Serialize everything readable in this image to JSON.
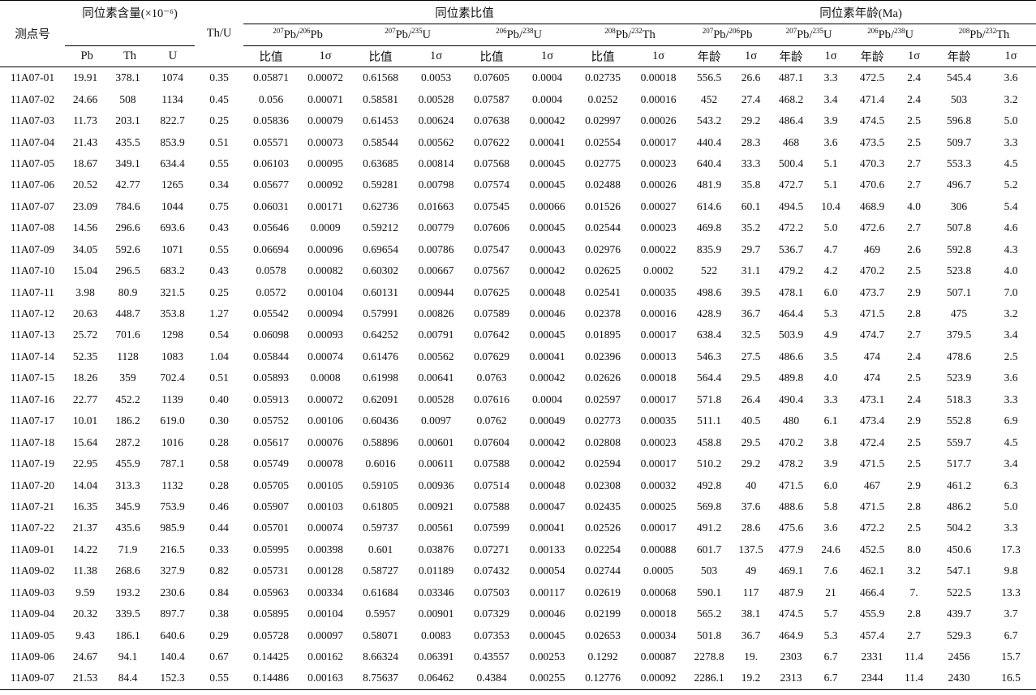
{
  "headers": {
    "point": "测点号",
    "content_group": "同位素含量(×10⁻⁶)",
    "th_u": "Th/U",
    "ratio_group": "同位素比值",
    "age_group": "同位素年龄(Ma)",
    "element_cols": [
      "Pb",
      "Th",
      "U"
    ],
    "pair_labels": [
      {
        "a_mass": "207",
        "a_el": "Pb",
        "b_mass": "206",
        "b_el": "Pb"
      },
      {
        "a_mass": "207",
        "a_el": "Pb",
        "b_mass": "235",
        "b_el": "U"
      },
      {
        "a_mass": "206",
        "a_el": "Pb",
        "b_mass": "238",
        "b_el": "U"
      },
      {
        "a_mass": "208",
        "a_el": "Pb",
        "b_mass": "232",
        "b_el": "Th"
      }
    ],
    "ratio_value": "比值",
    "age_value": "年龄",
    "sigma": "1σ"
  },
  "rows": [
    [
      "11A07-01",
      "19.91",
      "378.1",
      "1074",
      "0.35",
      "0.05871",
      "0.00072",
      "0.61568",
      "0.0053",
      "0.07605",
      "0.0004",
      "0.02735",
      "0.00018",
      "556.5",
      "26.6",
      "487.1",
      "3.3",
      "472.5",
      "2.4",
      "545.4",
      "3.6"
    ],
    [
      "11A07-02",
      "24.66",
      "508",
      "1134",
      "0.45",
      "0.056",
      "0.00071",
      "0.58581",
      "0.00528",
      "0.07587",
      "0.0004",
      "0.0252",
      "0.00016",
      "452",
      "27.4",
      "468.2",
      "3.4",
      "471.4",
      "2.4",
      "503",
      "3.2"
    ],
    [
      "11A07-03",
      "11.73",
      "203.1",
      "822.7",
      "0.25",
      "0.05836",
      "0.00079",
      "0.61453",
      "0.00624",
      "0.07638",
      "0.00042",
      "0.02997",
      "0.00026",
      "543.2",
      "29.2",
      "486.4",
      "3.9",
      "474.5",
      "2.5",
      "596.8",
      "5.0"
    ],
    [
      "11A07-04",
      "21.43",
      "435.5",
      "853.9",
      "0.51",
      "0.05571",
      "0.00073",
      "0.58544",
      "0.00562",
      "0.07622",
      "0.00041",
      "0.02554",
      "0.00017",
      "440.4",
      "28.3",
      "468",
      "3.6",
      "473.5",
      "2.5",
      "509.7",
      "3.3"
    ],
    [
      "11A07-05",
      "18.67",
      "349.1",
      "634.4",
      "0.55",
      "0.06103",
      "0.00095",
      "0.63685",
      "0.00814",
      "0.07568",
      "0.00045",
      "0.02775",
      "0.00023",
      "640.4",
      "33.3",
      "500.4",
      "5.1",
      "470.3",
      "2.7",
      "553.3",
      "4.5"
    ],
    [
      "11A07-06",
      "20.52",
      "42.77",
      "1265",
      "0.34",
      "0.05677",
      "0.00092",
      "0.59281",
      "0.00798",
      "0.07574",
      "0.00045",
      "0.02488",
      "0.00026",
      "481.9",
      "35.8",
      "472.7",
      "5.1",
      "470.6",
      "2.7",
      "496.7",
      "5.2"
    ],
    [
      "11A07-07",
      "23.09",
      "784.6",
      "1044",
      "0.75",
      "0.06031",
      "0.00171",
      "0.62736",
      "0.01663",
      "0.07545",
      "0.00066",
      "0.01526",
      "0.00027",
      "614.6",
      "60.1",
      "494.5",
      "10.4",
      "468.9",
      "4.0",
      "306",
      "5.4"
    ],
    [
      "11A07-08",
      "14.56",
      "296.6",
      "693.6",
      "0.43",
      "0.05646",
      "0.0009",
      "0.59212",
      "0.00779",
      "0.07606",
      "0.00045",
      "0.02544",
      "0.00023",
      "469.8",
      "35.2",
      "472.2",
      "5.0",
      "472.6",
      "2.7",
      "507.8",
      "4.6"
    ],
    [
      "11A07-09",
      "34.05",
      "592.6",
      "1071",
      "0.55",
      "0.06694",
      "0.00096",
      "0.69654",
      "0.00786",
      "0.07547",
      "0.00043",
      "0.02976",
      "0.00022",
      "835.9",
      "29.7",
      "536.7",
      "4.7",
      "469",
      "2.6",
      "592.8",
      "4.3"
    ],
    [
      "11A07-10",
      "15.04",
      "296.5",
      "683.2",
      "0.43",
      "0.0578",
      "0.00082",
      "0.60302",
      "0.00667",
      "0.07567",
      "0.00042",
      "0.02625",
      "0.0002",
      "522",
      "31.1",
      "479.2",
      "4.2",
      "470.2",
      "2.5",
      "523.8",
      "4.0"
    ],
    [
      "11A07-11",
      "3.98",
      "80.9",
      "321.5",
      "0.25",
      "0.0572",
      "0.00104",
      "0.60131",
      "0.00944",
      "0.07625",
      "0.00048",
      "0.02541",
      "0.00035",
      "498.6",
      "39.5",
      "478.1",
      "6.0",
      "473.7",
      "2.9",
      "507.1",
      "7.0"
    ],
    [
      "11A07-12",
      "20.63",
      "448.7",
      "353.8",
      "1.27",
      "0.05542",
      "0.00094",
      "0.57991",
      "0.00826",
      "0.07589",
      "0.00046",
      "0.02378",
      "0.00016",
      "428.9",
      "36.7",
      "464.4",
      "5.3",
      "471.5",
      "2.8",
      "475",
      "3.2"
    ],
    [
      "11A07-13",
      "25.72",
      "701.6",
      "1298",
      "0.54",
      "0.06098",
      "0.00093",
      "0.64252",
      "0.00791",
      "0.07642",
      "0.00045",
      "0.01895",
      "0.00017",
      "638.4",
      "32.5",
      "503.9",
      "4.9",
      "474.7",
      "2.7",
      "379.5",
      "3.4"
    ],
    [
      "11A07-14",
      "52.35",
      "1128",
      "1083",
      "1.04",
      "0.05844",
      "0.00074",
      "0.61476",
      "0.00562",
      "0.07629",
      "0.00041",
      "0.02396",
      "0.00013",
      "546.3",
      "27.5",
      "486.6",
      "3.5",
      "474",
      "2.4",
      "478.6",
      "2.5"
    ],
    [
      "11A07-15",
      "18.26",
      "359",
      "702.4",
      "0.51",
      "0.05893",
      "0.0008",
      "0.61998",
      "0.00641",
      "0.0763",
      "0.00042",
      "0.02626",
      "0.00018",
      "564.4",
      "29.5",
      "489.8",
      "4.0",
      "474",
      "2.5",
      "523.9",
      "3.6"
    ],
    [
      "11A07-16",
      "22.77",
      "452.2",
      "1139",
      "0.40",
      "0.05913",
      "0.00072",
      "0.62091",
      "0.00528",
      "0.07616",
      "0.0004",
      "0.02597",
      "0.00017",
      "571.8",
      "26.4",
      "490.4",
      "3.3",
      "473.1",
      "2.4",
      "518.3",
      "3.3"
    ],
    [
      "11A07-17",
      "10.01",
      "186.2",
      "619.0",
      "0.30",
      "0.05752",
      "0.00106",
      "0.60436",
      "0.0097",
      "0.0762",
      "0.00049",
      "0.02773",
      "0.00035",
      "511.1",
      "40.5",
      "480",
      "6.1",
      "473.4",
      "2.9",
      "552.8",
      "6.9"
    ],
    [
      "11A07-18",
      "15.64",
      "287.2",
      "1016",
      "0.28",
      "0.05617",
      "0.00076",
      "0.58896",
      "0.00601",
      "0.07604",
      "0.00042",
      "0.02808",
      "0.00023",
      "458.8",
      "29.5",
      "470.2",
      "3.8",
      "472.4",
      "2.5",
      "559.7",
      "4.5"
    ],
    [
      "11A07-19",
      "22.95",
      "455.9",
      "787.1",
      "0.58",
      "0.05749",
      "0.00078",
      "0.6016",
      "0.00611",
      "0.07588",
      "0.00042",
      "0.02594",
      "0.00017",
      "510.2",
      "29.2",
      "478.2",
      "3.9",
      "471.5",
      "2.5",
      "517.7",
      "3.4"
    ],
    [
      "11A07-20",
      "14.04",
      "313.3",
      "1132",
      "0.28",
      "0.05705",
      "0.00105",
      "0.59105",
      "0.00936",
      "0.07514",
      "0.00048",
      "0.02308",
      "0.00032",
      "492.8",
      "40",
      "471.5",
      "6.0",
      "467",
      "2.9",
      "461.2",
      "6.3"
    ],
    [
      "11A07-21",
      "16.35",
      "345.9",
      "753.9",
      "0.46",
      "0.05907",
      "0.00103",
      "0.61805",
      "0.00921",
      "0.07588",
      "0.00047",
      "0.02435",
      "0.00025",
      "569.8",
      "37.6",
      "488.6",
      "5.8",
      "471.5",
      "2.8",
      "486.2",
      "5.0"
    ],
    [
      "11A07-22",
      "21.37",
      "435.6",
      "985.9",
      "0.44",
      "0.05701",
      "0.00074",
      "0.59737",
      "0.00561",
      "0.07599",
      "0.00041",
      "0.02526",
      "0.00017",
      "491.2",
      "28.6",
      "475.6",
      "3.6",
      "472.2",
      "2.5",
      "504.2",
      "3.3"
    ],
    [
      "11A09-01",
      "14.22",
      "71.9",
      "216.5",
      "0.33",
      "0.05995",
      "0.00398",
      "0.601",
      "0.03876",
      "0.07271",
      "0.00133",
      "0.02254",
      "0.00088",
      "601.7",
      "137.5",
      "477.9",
      "24.6",
      "452.5",
      "8.0",
      "450.6",
      "17.3"
    ],
    [
      "11A09-02",
      "11.38",
      "268.6",
      "327.9",
      "0.82",
      "0.05731",
      "0.00128",
      "0.58727",
      "0.01189",
      "0.07432",
      "0.00054",
      "0.02744",
      "0.0005",
      "503",
      "49",
      "469.1",
      "7.6",
      "462.1",
      "3.2",
      "547.1",
      "9.8"
    ],
    [
      "11A09-03",
      "9.59",
      "193.2",
      "230.6",
      "0.84",
      "0.05963",
      "0.00334",
      "0.61684",
      "0.03346",
      "0.07503",
      "0.00117",
      "0.02619",
      "0.00068",
      "590.1",
      "117",
      "487.9",
      "21",
      "466.4",
      "7.",
      "522.5",
      "13.3"
    ],
    [
      "11A09-04",
      "20.32",
      "339.5",
      "897.7",
      "0.38",
      "0.05895",
      "0.00104",
      "0.5957",
      "0.00901",
      "0.07329",
      "0.00046",
      "0.02199",
      "0.00018",
      "565.2",
      "38.1",
      "474.5",
      "5.7",
      "455.9",
      "2.8",
      "439.7",
      "3.7"
    ],
    [
      "11A09-05",
      "9.43",
      "186.1",
      "640.6",
      "0.29",
      "0.05728",
      "0.00097",
      "0.58071",
      "0.0083",
      "0.07353",
      "0.00045",
      "0.02653",
      "0.00034",
      "501.8",
      "36.7",
      "464.9",
      "5.3",
      "457.4",
      "2.7",
      "529.3",
      "6.7"
    ],
    [
      "11A09-06",
      "24.67",
      "94.1",
      "140.4",
      "0.67",
      "0.14425",
      "0.00162",
      "8.66324",
      "0.06391",
      "0.43557",
      "0.00253",
      "0.1292",
      "0.00087",
      "2278.8",
      "19.",
      "2303",
      "6.7",
      "2331",
      "11.4",
      "2456",
      "15.7"
    ],
    [
      "11A09-07",
      "21.53",
      "84.4",
      "152.3",
      "0.55",
      "0.14486",
      "0.00163",
      "8.75637",
      "0.06462",
      "0.4384",
      "0.00255",
      "0.12776",
      "0.00092",
      "2286.1",
      "19.2",
      "2313",
      "6.7",
      "2344",
      "11.4",
      "2430",
      "16.5"
    ]
  ]
}
